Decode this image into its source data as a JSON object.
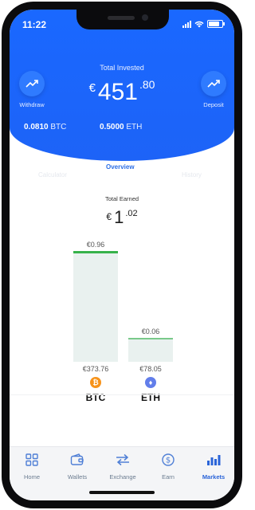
{
  "status": {
    "time": "11:22"
  },
  "header": {
    "total_label": "Total Invested",
    "currency": "€",
    "amount_int": "451",
    "amount_dec": ".80",
    "withdraw_label": "Withdraw",
    "deposit_label": "Deposit",
    "btc_balance": "0.0810",
    "btc_symbol": "BTC",
    "eth_balance": "0.5000",
    "eth_symbol": "ETH"
  },
  "tabs": {
    "calculator": "Calculator",
    "overview": "Overview",
    "history": "History"
  },
  "earned": {
    "label": "Total Earned",
    "currency": "€",
    "int": "1",
    "dec": ".02"
  },
  "chart_data": {
    "type": "bar",
    "categories": [
      "BTC",
      "ETH"
    ],
    "invested_labels": [
      "€373.76",
      "€78.05"
    ],
    "earned_labels": [
      "€0.96",
      "€0.06"
    ],
    "series": [
      {
        "values": [
          373.76,
          78.05
        ]
      },
      {
        "values": [
          0.96,
          0.06
        ]
      }
    ],
    "colors": {
      "BTC": "#f7931a",
      "ETH": "#627eea",
      "btc_bar_top": "#36b24a",
      "eth_bar_top": "#79c98a",
      "bar_fill": "#e9f1ef"
    }
  },
  "nav": {
    "items": [
      {
        "label": "Home",
        "icon": "grid-icon"
      },
      {
        "label": "Wallets",
        "icon": "wallet-icon"
      },
      {
        "label": "Exchange",
        "icon": "exchange-icon"
      },
      {
        "label": "Earn",
        "icon": "dollar-icon"
      },
      {
        "label": "Markets",
        "icon": "bar-chart-icon"
      }
    ],
    "active": "Markets"
  }
}
